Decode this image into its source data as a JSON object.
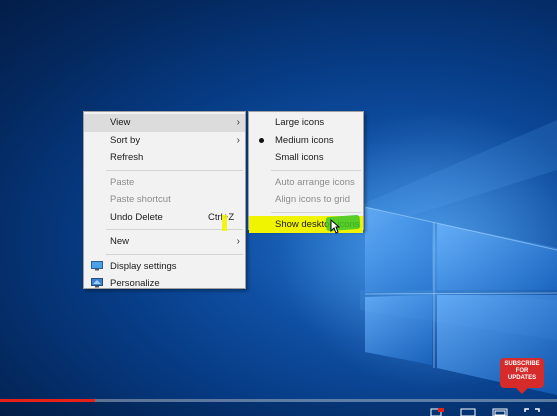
{
  "main_menu": {
    "items": [
      {
        "label": "View",
        "has_submenu": true,
        "state": "highlighted"
      },
      {
        "label": "Sort by",
        "has_submenu": true
      },
      {
        "label": "Refresh"
      },
      {
        "label": "Paste",
        "disabled": true
      },
      {
        "label": "Paste shortcut",
        "disabled": true
      },
      {
        "label": "Undo Delete",
        "shortcut": "Ctrl+Z"
      },
      {
        "label": "New",
        "has_submenu": true
      },
      {
        "label": "Display settings",
        "icon": "display-settings-icon"
      },
      {
        "label": "Personalize",
        "icon": "personalize-icon"
      }
    ]
  },
  "view_submenu": {
    "items": [
      {
        "label": "Large icons"
      },
      {
        "label": "Medium icons",
        "selected": true
      },
      {
        "label": "Small icons"
      },
      {
        "label": "Auto arrange icons",
        "disabled": true
      },
      {
        "label": "Align icons to grid",
        "disabled": true
      },
      {
        "label": "Show desktop icons",
        "state": "highlighted",
        "checked": false
      }
    ]
  },
  "overlay": {
    "subscribe_badge": {
      "line1": "SUBSCRIBE",
      "line2": "FOR",
      "line3": "UPDATES"
    }
  },
  "player": {
    "progress": 0.17
  },
  "colors": {
    "desktop_bg": "#063a82",
    "menu_bg": "#f2f2f2",
    "highlight_yellow": "#f3f400",
    "highlight_green": "#3ec72e",
    "progress_red": "#e62117"
  }
}
